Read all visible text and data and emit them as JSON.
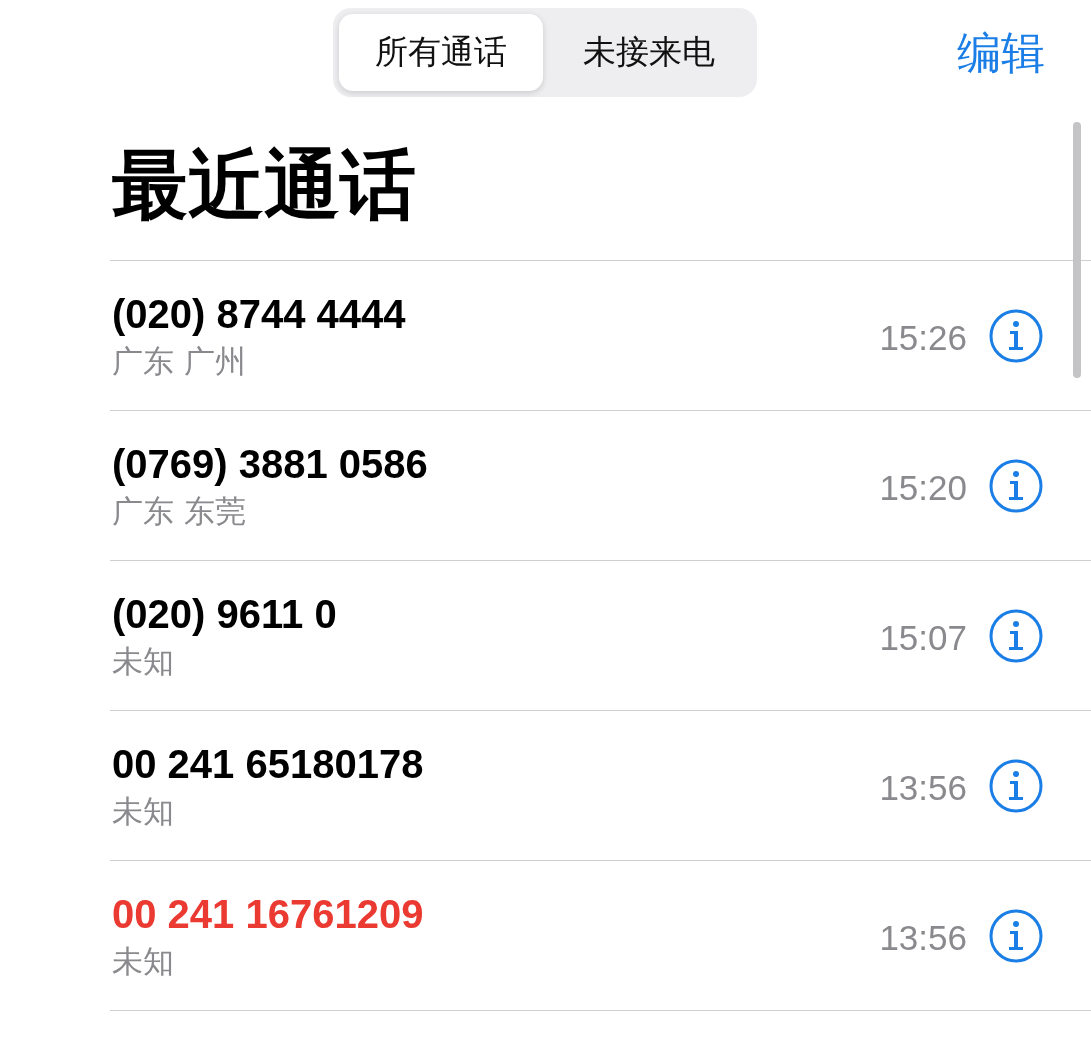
{
  "segments": [
    {
      "label": "所有通话",
      "selected": true
    },
    {
      "label": "未接来电",
      "selected": false
    }
  ],
  "edit_button": "编辑",
  "title": "最近通话",
  "calls": [
    {
      "number": "(020) 8744 4444",
      "location": "广东 广州",
      "time": "15:26",
      "missed": false
    },
    {
      "number": "(0769) 3881 0586",
      "location": "广东 东莞",
      "time": "15:20",
      "missed": false
    },
    {
      "number": "(020) 9611 0",
      "location": "未知",
      "time": "15:07",
      "missed": false
    },
    {
      "number": "00 241 65180178",
      "location": "未知",
      "time": "13:56",
      "missed": false
    },
    {
      "number": "00 241 16761209",
      "location": "未知",
      "time": "13:56",
      "missed": true
    }
  ]
}
